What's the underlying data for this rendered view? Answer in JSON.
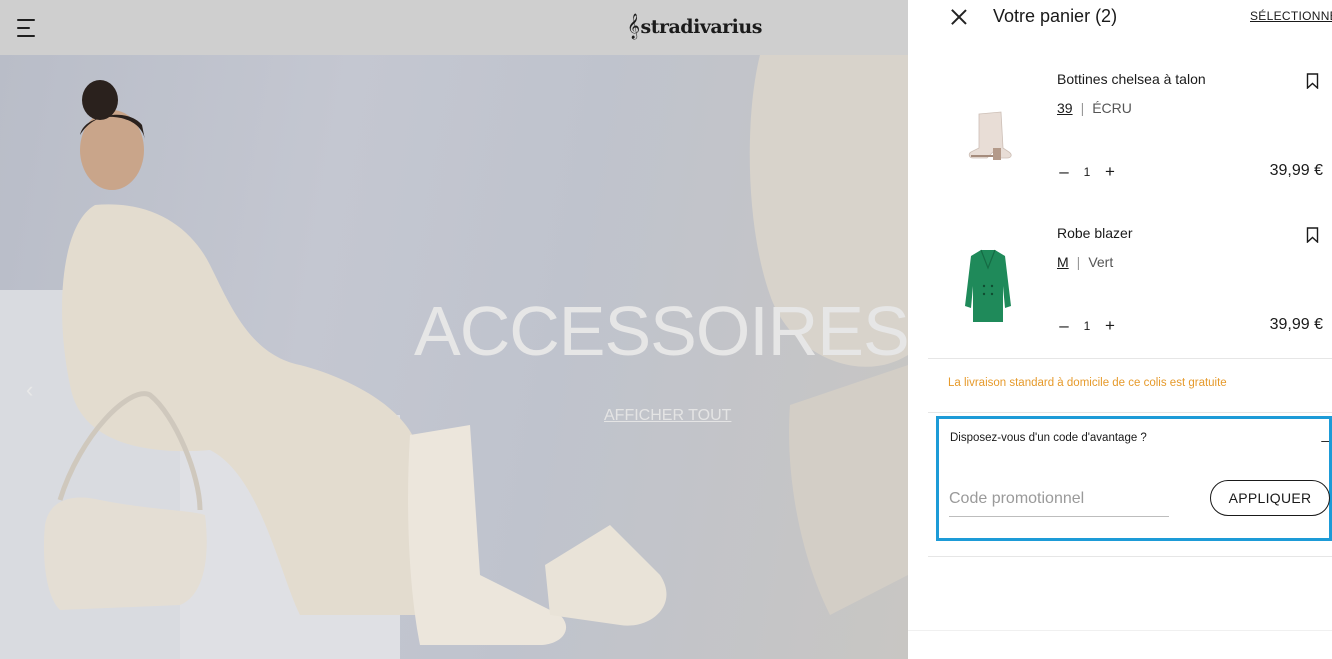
{
  "page": {
    "logo": "stradivarius",
    "hero_title": "ACCESSOIRES",
    "hero_link": "AFFICHER TOUT",
    "prev_arrow": "‹"
  },
  "cart": {
    "title": "Votre panier (2)",
    "select_label": "SÉLECTIONNER",
    "items": [
      {
        "name": "Bottines chelsea à talon",
        "size": "39",
        "color": "ÉCRU",
        "quantity": "1",
        "price": "39,99 €",
        "decrement": "–",
        "increment": "+"
      },
      {
        "name": "Robe blazer",
        "size": "M",
        "color": "Vert",
        "quantity": "1",
        "price": "39,99 €",
        "decrement": "–",
        "increment": "+"
      }
    ],
    "shipping_notice": "La livraison standard à domicile de ce colis est gratuite",
    "promo": {
      "question": "Disposez-vous d'un code d'avantage ?",
      "toggle": "–",
      "placeholder": "Code promotionnel",
      "value": "",
      "apply_label": "APPLIQUER"
    }
  },
  "colors": {
    "shipping_notice": "#e69a2b",
    "promo_highlight": "#1d9bd7",
    "coat": "#1f8a5a",
    "boot": "#e8ddd6"
  },
  "icons": [
    "menu-icon",
    "close-icon",
    "bookmark-icon",
    "chevron-left-icon"
  ]
}
